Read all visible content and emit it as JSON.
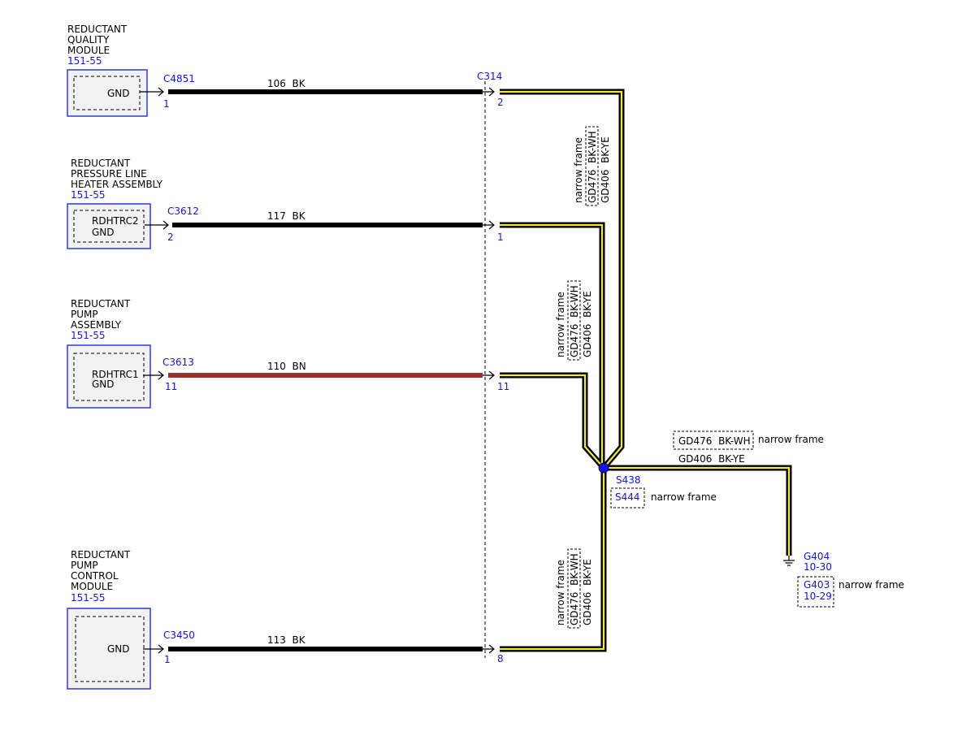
{
  "colors": {
    "module_border": "#2a3ae0",
    "module_fill": "#f2f2f2",
    "wire_black": "#000000",
    "wire_brown": "#a0302a",
    "shield_yellow": "#f2ea2a",
    "splice_dot": "#1212ee",
    "link_text": "#1414e6"
  },
  "modules": [
    {
      "name_lines": [
        "REDUCTANT",
        "QUALITY",
        "MODULE"
      ],
      "ref": "151-55",
      "pins": [
        "GND"
      ],
      "connector": "C4851",
      "pin_number": "1",
      "wire": "106  BK",
      "c314_pin": "2"
    },
    {
      "name_lines": [
        "REDUCTANT",
        "PRESSURE LINE",
        "HEATER ASSEMBLY"
      ],
      "ref": "151-55",
      "pins": [
        "RDHTRC2",
        "GND"
      ],
      "connector": "C3612",
      "pin_number": "2",
      "wire": "117  BK",
      "c314_pin": "1"
    },
    {
      "name_lines": [
        "REDUCTANT",
        "PUMP",
        "ASSEMBLY"
      ],
      "ref": "151-55",
      "pins": [
        "RDHTRC1",
        "GND"
      ],
      "connector": "C3613",
      "pin_number": "11",
      "wire": "110  BN",
      "c314_pin": "11"
    },
    {
      "name_lines": [
        "REDUCTANT",
        "PUMP",
        "CONTROL",
        "MODULE"
      ],
      "ref": "151-55",
      "pins": [
        "GND"
      ],
      "connector": "C3450",
      "pin_number": "1",
      "wire": "113  BK",
      "c314_pin": "8"
    }
  ],
  "inline_connector": "C314",
  "vertical_labels": {
    "note": "narrow frame",
    "circuit_a": "GD476  BK-WH",
    "circuit_b": "GD406  BK-YE"
  },
  "splice": {
    "primary": "S438",
    "alternate": "S444",
    "alternate_note": "narrow frame"
  },
  "ground_wire": {
    "alt_circuit": "GD476  BK-WH",
    "alt_note": "narrow frame",
    "circuit": "GD406  BK-YE"
  },
  "ground": {
    "primary": "G404",
    "primary_ref": "10-30",
    "alternate": "G403",
    "alternate_ref": "10-29",
    "alternate_note": "narrow frame"
  }
}
